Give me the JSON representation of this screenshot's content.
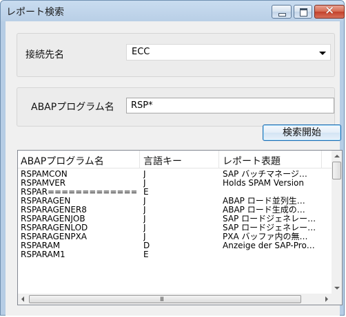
{
  "window": {
    "title": "レポート検索"
  },
  "connection": {
    "label": "接続先名",
    "selected": "ECC"
  },
  "program_filter": {
    "label": "ABAPプログラム名",
    "value": "RSP*"
  },
  "search_button": "検索開始",
  "table": {
    "columns": [
      "ABAPプログラム名",
      "言語キー",
      "レポート表題"
    ],
    "rows": [
      [
        "RSPAMCON",
        "J",
        "SAP バッチマネージ…"
      ],
      [
        "RSPAMVER",
        "J",
        "Holds SPAM Version"
      ],
      [
        "RSPAR==============…",
        "E",
        ""
      ],
      [
        "RSPARAGEN",
        "J",
        "ABAP ロード並列生…"
      ],
      [
        "RSPARAGENER8",
        "J",
        "ABAP ロード生成の…"
      ],
      [
        "RSPARAGENJOB",
        "J",
        "SAP ロードジェネレー…"
      ],
      [
        "RSPARAGENLOD",
        "J",
        "SAP ロードジェネレー…"
      ],
      [
        "RSPARAGENPXA",
        "J",
        "PXA バッファ内の無…"
      ],
      [
        "RSPARAM",
        "D",
        "Anzeige der SAP-Pro…"
      ],
      [
        "RSPARAM1",
        "E",
        ""
      ]
    ]
  }
}
